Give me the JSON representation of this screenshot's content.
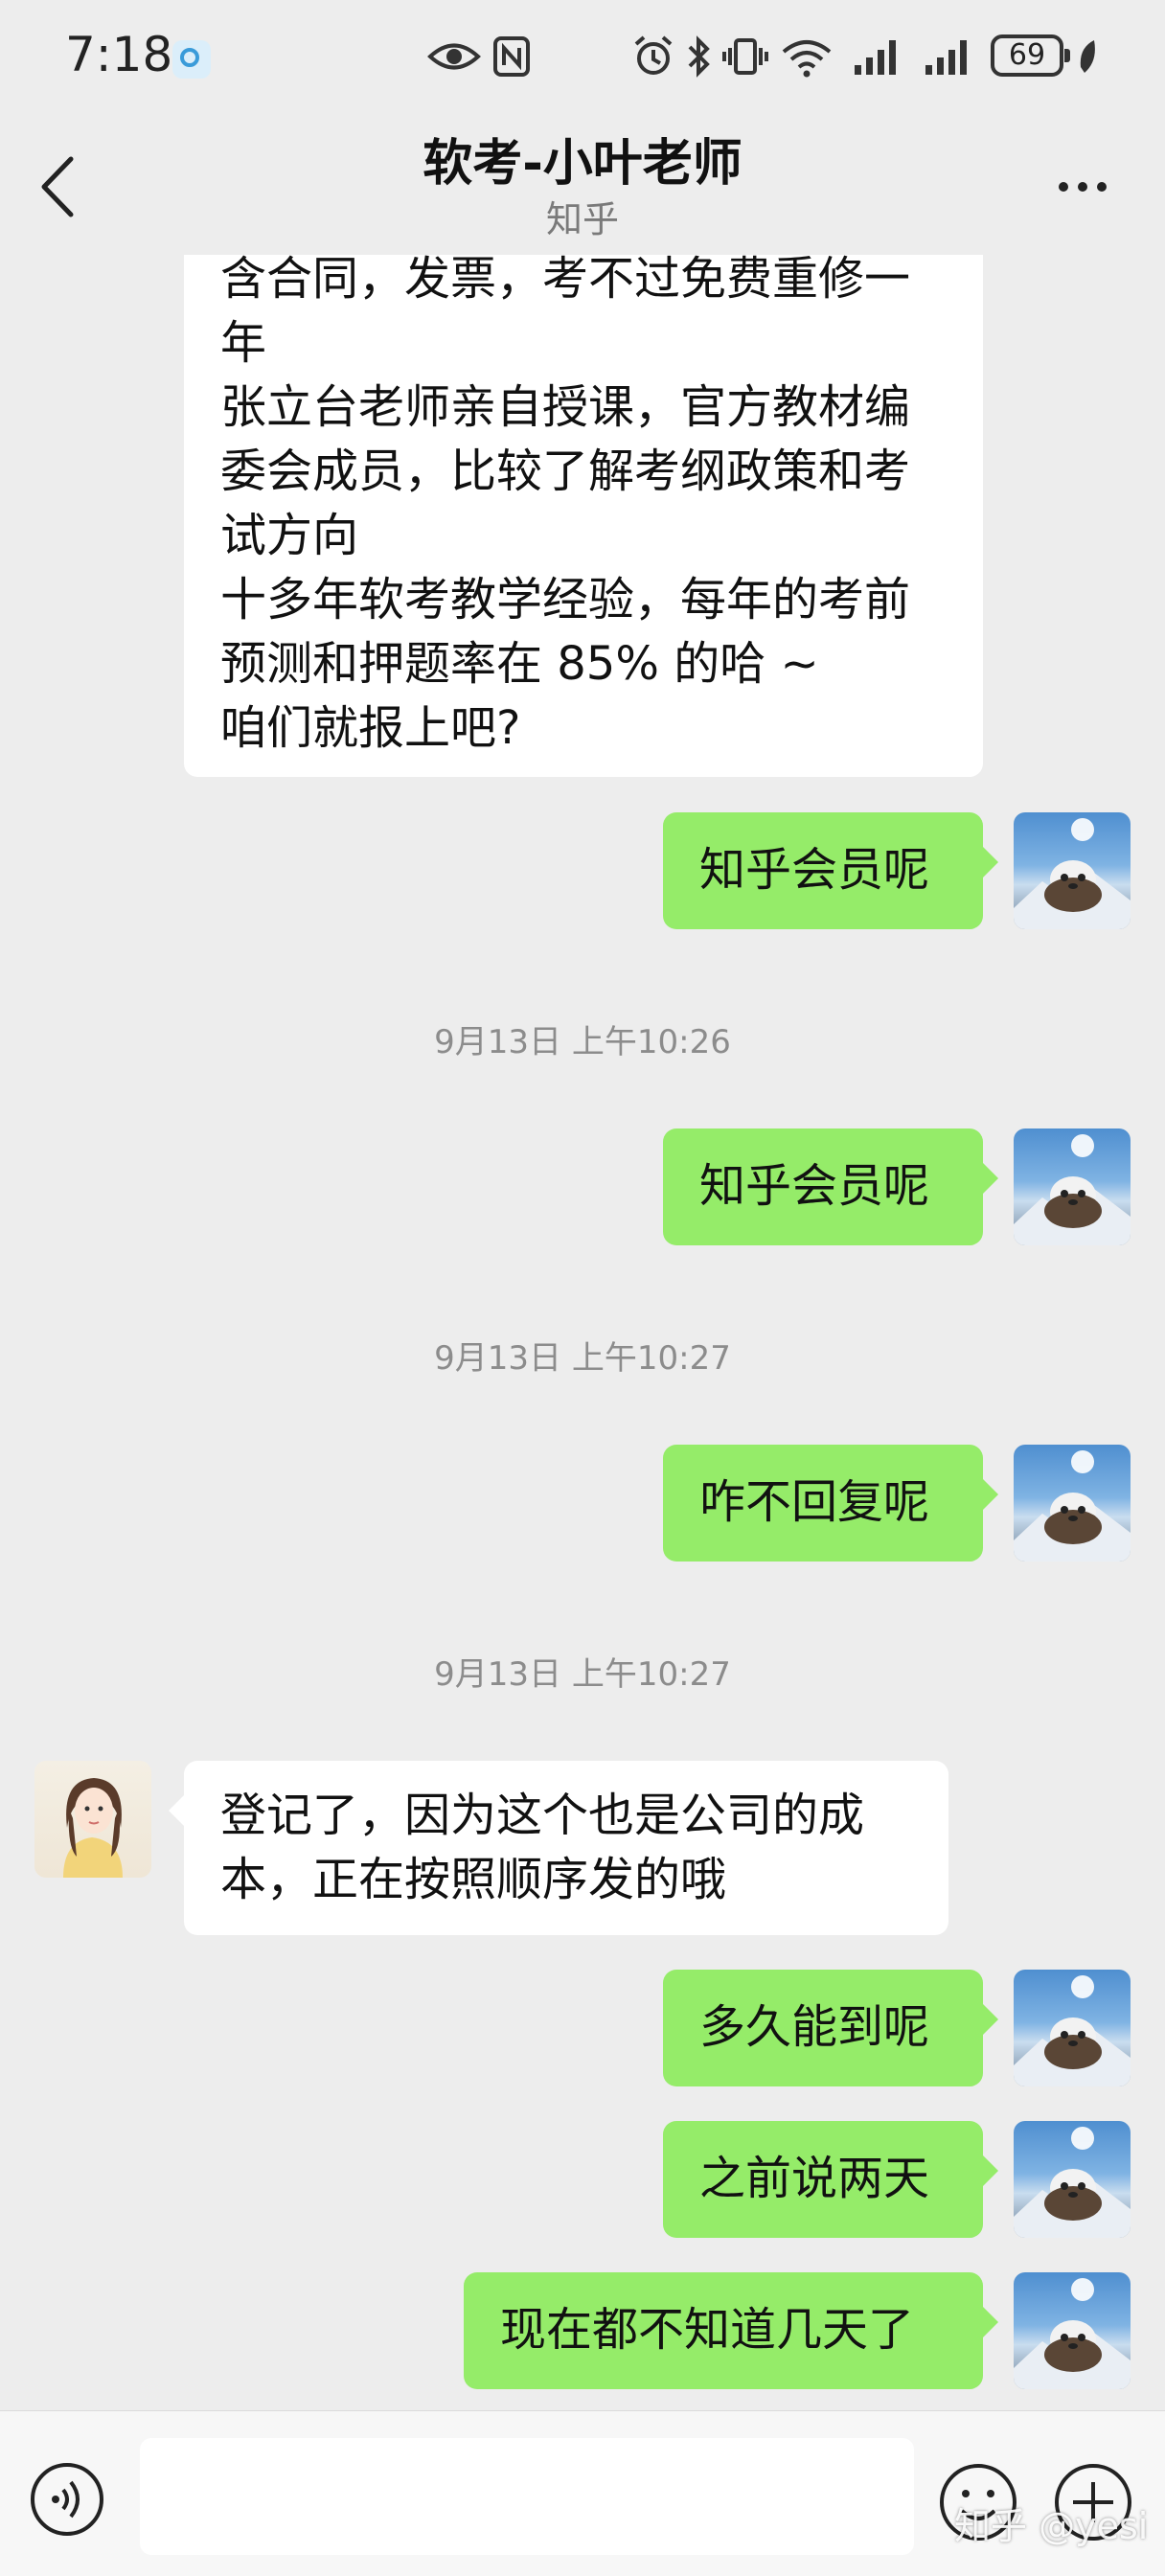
{
  "status_bar": {
    "time": "7:18",
    "battery": "69",
    "icons": [
      "notification-app-icon",
      "eye-icon",
      "nfc-icon",
      "alarm-icon",
      "bluetooth-icon",
      "vibrate-icon",
      "wifi-icon",
      "signal-icon",
      "signal-icon",
      "battery-icon",
      "leaf-icon"
    ]
  },
  "header": {
    "title": "软考-小叶老师",
    "subtitle": "知乎",
    "back_icon": "chevron-left-icon",
    "more_icon": "more-dots-icon"
  },
  "messages": [
    {
      "from": "teacher",
      "lines": [
        "含合同，发票，考不过免费重修一",
        "年",
        "张立台老师亲自授课，官方教材编",
        "委会成员，比较了解考纲政策和考",
        "试方向",
        "十多年软考教学经验，每年的考前",
        "预测和押题率在 85% 的哈 ~",
        "咱们就报上吧?"
      ]
    },
    {
      "from": "me",
      "lines": [
        "知乎会员呢"
      ]
    },
    {
      "timestamp": "9月13日 上午10:26"
    },
    {
      "from": "me",
      "lines": [
        "知乎会员呢"
      ]
    },
    {
      "timestamp": "9月13日 上午10:27"
    },
    {
      "from": "me",
      "lines": [
        "咋不回复呢"
      ]
    },
    {
      "timestamp": "9月13日 上午10:27"
    },
    {
      "from": "teacher",
      "lines": [
        "登记了，因为这个也是公司的成",
        "本，正在按照顺序发的哦"
      ]
    },
    {
      "from": "me",
      "lines": [
        "多久能到呢"
      ]
    },
    {
      "from": "me",
      "lines": [
        "之前说两天"
      ]
    },
    {
      "from": "me",
      "lines": [
        "现在都不知道几天了"
      ]
    }
  ],
  "input_bar": {
    "voice_icon": "voice-icon",
    "emoji_icon": "emoji-icon",
    "plus_icon": "plus-icon",
    "input_value": ""
  },
  "watermark": "知乎 @yesi",
  "colors": {
    "background": "#ededed",
    "incoming_bubble": "#ffffff",
    "outgoing_bubble": "#95ec69",
    "timestamp_text": "#8c8c8c"
  }
}
